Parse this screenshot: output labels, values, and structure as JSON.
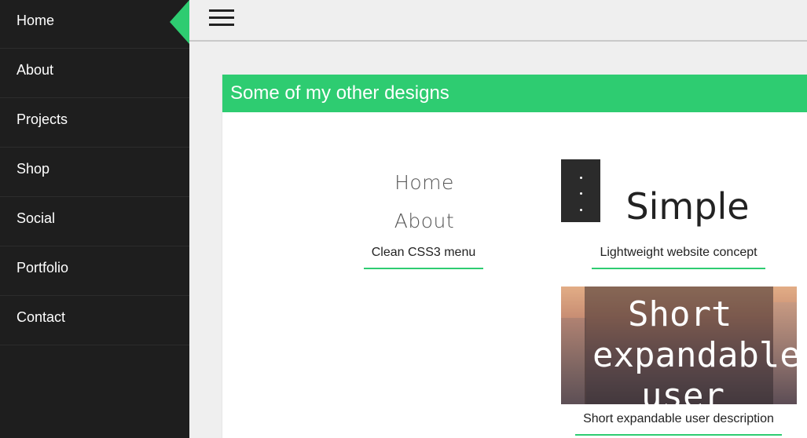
{
  "sidebar": {
    "items": [
      {
        "label": "Home",
        "active": true
      },
      {
        "label": "About"
      },
      {
        "label": "Projects"
      },
      {
        "label": "Shop"
      },
      {
        "label": "Social"
      },
      {
        "label": "Portfolio"
      },
      {
        "label": "Contact"
      }
    ]
  },
  "topbar": {
    "menu_icon": "hamburger-menu-icon"
  },
  "panel": {
    "title": "Some of my other designs",
    "cards": [
      {
        "preview_items": [
          "Home",
          "About"
        ],
        "caption": "Clean CSS3 menu"
      },
      {
        "preview_text": "Simple",
        "caption": "Lightweight website concept"
      },
      {
        "preview_lines": [
          "Short",
          "expandable",
          "user"
        ],
        "caption": "Short expandable user description"
      }
    ]
  },
  "colors": {
    "accent": "#2ecc71",
    "sidebar_bg": "#1e1e1e",
    "page_bg": "#efefef"
  }
}
